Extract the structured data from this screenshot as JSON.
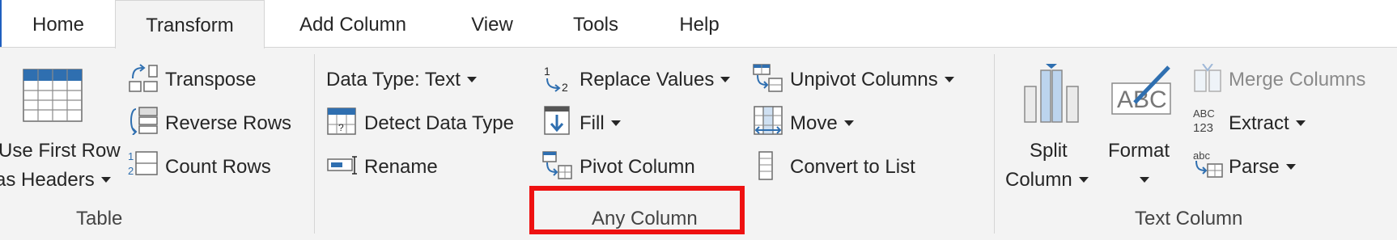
{
  "tabs": [
    "Home",
    "Transform",
    "Add Column",
    "View",
    "Tools",
    "Help"
  ],
  "active_tab": "Transform",
  "table_group": {
    "use_first_row_line1": "Use First Row",
    "use_first_row_line2": "as Headers",
    "transpose": "Transpose",
    "reverse_rows": "Reverse Rows",
    "count_rows": "Count Rows",
    "label": "Table"
  },
  "any_column_group": {
    "data_type": "Data Type: Text",
    "detect_data_type": "Detect Data Type",
    "rename": "Rename",
    "replace_values": "Replace Values",
    "fill": "Fill",
    "pivot_column": "Pivot Column",
    "unpivot_columns": "Unpivot Columns",
    "move": "Move",
    "convert_to_list": "Convert to List",
    "label": "Any Column"
  },
  "text_column_group": {
    "split_column_line1": "Split",
    "split_column_line2": "Column",
    "format": "Format",
    "merge_columns": "Merge Columns",
    "extract": "Extract",
    "parse": "Parse",
    "label": "Text Column"
  },
  "icon_text": {
    "replace_values_1": "1",
    "replace_values_2": "2",
    "count_rows_1": "1",
    "count_rows_2": "2",
    "detect_type_q": "?",
    "format_abc": "ABC",
    "extract_abc": "ABC",
    "extract_123": "123",
    "parse_abc": "abc"
  },
  "highlight_color": "#ee1111"
}
